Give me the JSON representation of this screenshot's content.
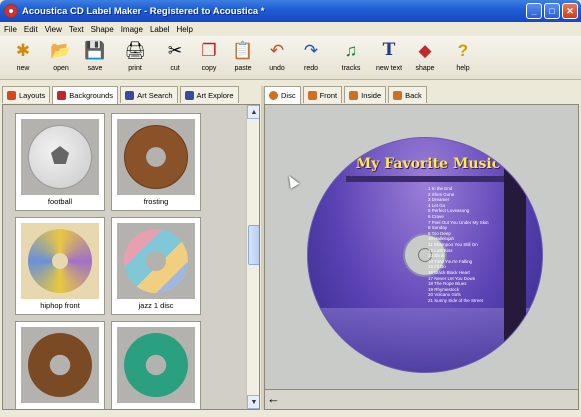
{
  "window": {
    "title": "Acoustica CD Label Maker - Registered to Acoustica *"
  },
  "menu": [
    "File",
    "Edit",
    "View",
    "Text",
    "Shape",
    "Image",
    "Label",
    "Help"
  ],
  "toolbar": [
    {
      "label": "new",
      "icon": "new-icon",
      "glyph": "✱"
    },
    {
      "label": "open",
      "icon": "open-folder-icon",
      "glyph": "📂"
    },
    {
      "label": "save",
      "icon": "save-disk-icon",
      "glyph": "💾"
    },
    {
      "label": "print",
      "icon": "printer-icon",
      "glyph": "🖨"
    },
    {
      "label": "cut",
      "icon": "scissors-icon",
      "glyph": "✂"
    },
    {
      "label": "copy",
      "icon": "copy-icon",
      "glyph": "❐"
    },
    {
      "label": "paste",
      "icon": "paste-icon",
      "glyph": "📋"
    },
    {
      "label": "undo",
      "icon": "undo-icon",
      "glyph": "↶"
    },
    {
      "label": "redo",
      "icon": "redo-icon",
      "glyph": "↷"
    },
    {
      "label": "tracks",
      "icon": "tracks-icon",
      "glyph": "♫"
    },
    {
      "label": "new text",
      "icon": "new-text-icon",
      "glyph": "T"
    },
    {
      "label": "shape",
      "icon": "shape-icon",
      "glyph": "◆"
    },
    {
      "label": "help",
      "icon": "help-icon",
      "glyph": "?"
    }
  ],
  "left_tabs": [
    {
      "label": "Layouts",
      "color": "#d64a1a"
    },
    {
      "label": "Backgrounds",
      "color": "#c0282a"
    },
    {
      "label": "Art Search",
      "color": "#3a4aa0"
    },
    {
      "label": "Art Explore",
      "color": "#3a4aa0"
    }
  ],
  "right_tabs": [
    {
      "label": "Disc",
      "color": "#d07020"
    },
    {
      "label": "Front",
      "color": "#d07020"
    },
    {
      "label": "Inside",
      "color": "#d07020"
    },
    {
      "label": "Back",
      "color": "#d07020"
    }
  ],
  "backgrounds": [
    {
      "name": "football",
      "style": "football"
    },
    {
      "name": "frosting",
      "style": "frosting"
    },
    {
      "name": "hiphop front",
      "style": "hiphop"
    },
    {
      "name": "jazz 1 disc",
      "style": "jazz"
    },
    {
      "name": "",
      "style": "brown"
    },
    {
      "name": "",
      "style": "green"
    }
  ],
  "disc": {
    "title": "My Favorite Music",
    "tracks": [
      "1 In the End",
      "2 Shes Gone",
      "3 Dreamer",
      "4 Let Go",
      "5 Perfect Loveasong",
      "6 Crave",
      "7 Feel Out You Under My Skin",
      "8 Sunday",
      "9 Too Deep",
      "10 Hallelujah",
      "11 Shampoo You Still On",
      "12 Last Kiss",
      "13 Blink",
      "14 Time You're Falling",
      "15 Fil Bo",
      "16 Black Black Heart",
      "17 Never Let You Down",
      "18 The Rope Blues",
      "19 Rhymestock",
      "20 Volcano Girls",
      "21 Sunny Side of the Street"
    ]
  }
}
